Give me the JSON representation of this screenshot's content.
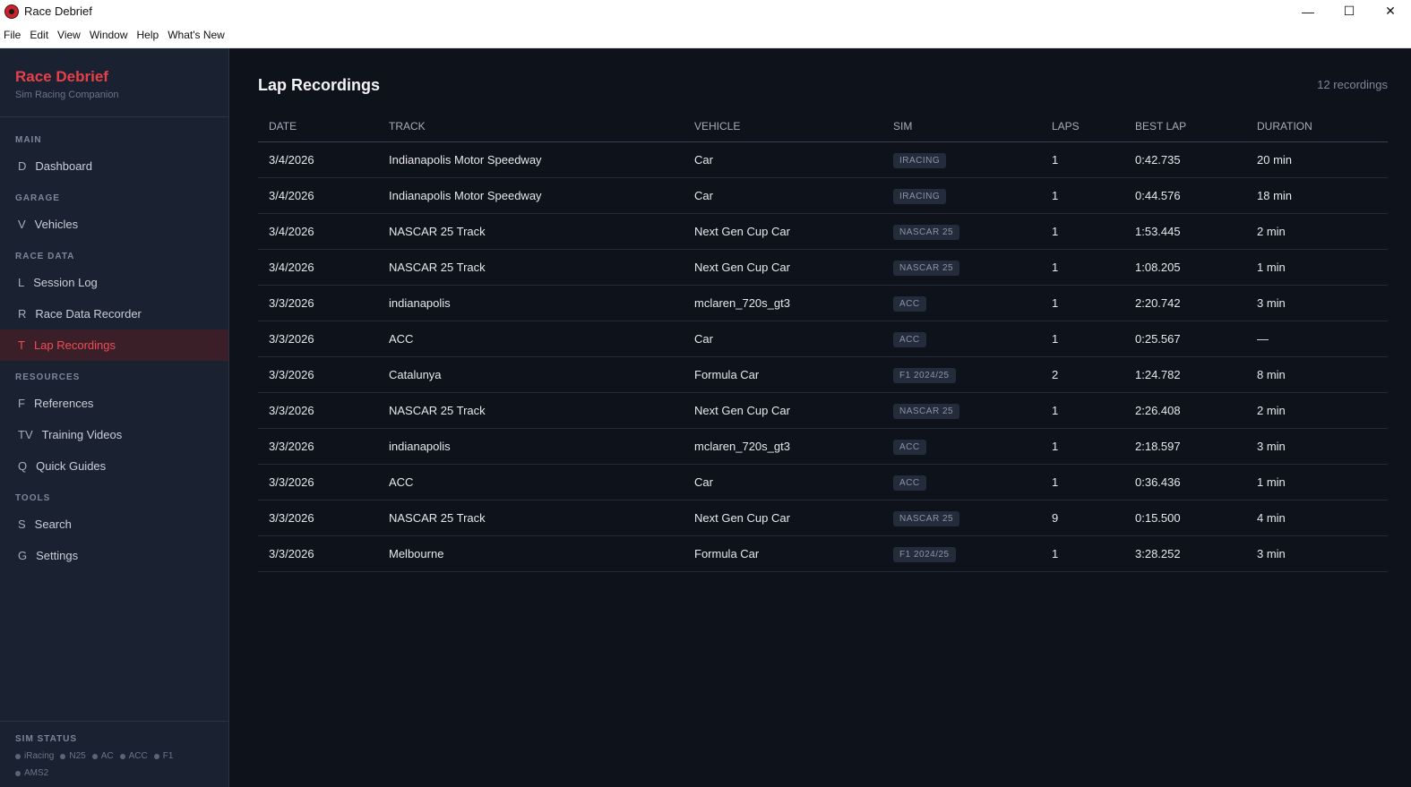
{
  "window": {
    "title": "Race Debrief",
    "controls": {
      "minimize": "—",
      "maximize": "☐",
      "close": "✕"
    }
  },
  "menu": [
    "File",
    "Edit",
    "View",
    "Window",
    "Help",
    "What's New"
  ],
  "sidebar": {
    "brand_title": "Race Debrief",
    "brand_subtitle": "Sim Racing Companion",
    "sections": [
      {
        "label": "MAIN",
        "items": [
          {
            "icon": "D",
            "label": "Dashboard"
          }
        ]
      },
      {
        "label": "GARAGE",
        "items": [
          {
            "icon": "V",
            "label": "Vehicles"
          }
        ]
      },
      {
        "label": "RACE DATA",
        "items": [
          {
            "icon": "L",
            "label": "Session Log"
          },
          {
            "icon": "R",
            "label": "Race Data Recorder"
          },
          {
            "icon": "T",
            "label": "Lap Recordings",
            "active": true
          }
        ]
      },
      {
        "label": "RESOURCES",
        "items": [
          {
            "icon": "F",
            "label": "References"
          },
          {
            "icon": "TV",
            "label": "Training Videos"
          },
          {
            "icon": "Q",
            "label": "Quick Guides"
          }
        ]
      },
      {
        "label": "TOOLS",
        "items": [
          {
            "icon": "S",
            "label": "Search"
          },
          {
            "icon": "G",
            "label": "Settings"
          }
        ]
      }
    ],
    "sim_status": {
      "label": "SIM STATUS",
      "sims": [
        "iRacing",
        "N25",
        "AC",
        "ACC",
        "F1",
        "AMS2"
      ]
    }
  },
  "main": {
    "title": "Lap Recordings",
    "count": "12 recordings",
    "columns": [
      "DATE",
      "TRACK",
      "VEHICLE",
      "SIM",
      "LAPS",
      "BEST LAP",
      "DURATION"
    ],
    "rows": [
      [
        "3/4/2026",
        "Indianapolis Motor Speedway",
        "Car",
        "IRACING",
        "1",
        "0:42.735",
        "20 min"
      ],
      [
        "3/4/2026",
        "Indianapolis Motor Speedway",
        "Car",
        "IRACING",
        "1",
        "0:44.576",
        "18 min"
      ],
      [
        "3/4/2026",
        "NASCAR 25 Track",
        "Next Gen Cup Car",
        "NASCAR 25",
        "1",
        "1:53.445",
        "2 min"
      ],
      [
        "3/4/2026",
        "NASCAR 25 Track",
        "Next Gen Cup Car",
        "NASCAR 25",
        "1",
        "1:08.205",
        "1 min"
      ],
      [
        "3/3/2026",
        "indianapolis",
        "mclaren_720s_gt3",
        "ACC",
        "1",
        "2:20.742",
        "3 min"
      ],
      [
        "3/3/2026",
        "ACC",
        "Car",
        "ACC",
        "1",
        "0:25.567",
        "—"
      ],
      [
        "3/3/2026",
        "Catalunya",
        "Formula Car",
        "F1 2024/25",
        "2",
        "1:24.782",
        "8 min"
      ],
      [
        "3/3/2026",
        "NASCAR 25 Track",
        "Next Gen Cup Car",
        "NASCAR 25",
        "1",
        "2:26.408",
        "2 min"
      ],
      [
        "3/3/2026",
        "indianapolis",
        "mclaren_720s_gt3",
        "ACC",
        "1",
        "2:18.597",
        "3 min"
      ],
      [
        "3/3/2026",
        "ACC",
        "Car",
        "ACC",
        "1",
        "0:36.436",
        "1 min"
      ],
      [
        "3/3/2026",
        "NASCAR 25 Track",
        "Next Gen Cup Car",
        "NASCAR 25",
        "9",
        "0:15.500",
        "4 min"
      ],
      [
        "3/3/2026",
        "Melbourne",
        "Formula Car",
        "F1 2024/25",
        "1",
        "3:28.252",
        "3 min"
      ]
    ]
  }
}
